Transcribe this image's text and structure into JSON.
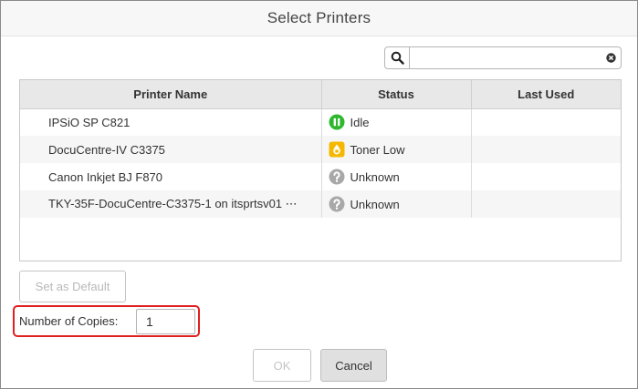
{
  "dialog": {
    "title": "Select Printers"
  },
  "search": {
    "value": "",
    "placeholder": ""
  },
  "table": {
    "columns": [
      "Printer Name",
      "Status",
      "Last Used"
    ],
    "rows": [
      {
        "name": "IPSiO SP C821",
        "status": "Idle",
        "status_icon": "idle-icon",
        "last_used": ""
      },
      {
        "name": "DocuCentre-IV C3375",
        "status": "Toner Low",
        "status_icon": "toner-low-icon",
        "last_used": ""
      },
      {
        "name": "Canon Inkjet BJ F870",
        "status": "Unknown",
        "status_icon": "unknown-icon",
        "last_used": ""
      },
      {
        "name": "TKY-35F-DocuCentre-C3375-1 on itsprtsv01 ⋯",
        "status": "Unknown",
        "status_icon": "unknown-icon",
        "last_used": ""
      }
    ]
  },
  "actions": {
    "set_default_label": "Set as Default",
    "ok_label": "OK",
    "cancel_label": "Cancel"
  },
  "copies": {
    "label": "Number of Copies:",
    "value": "1"
  },
  "colors": {
    "idle": "#2db82d",
    "toner_low": "#f5b800",
    "unknown": "#a8a8a8",
    "highlight": "#e02020"
  }
}
